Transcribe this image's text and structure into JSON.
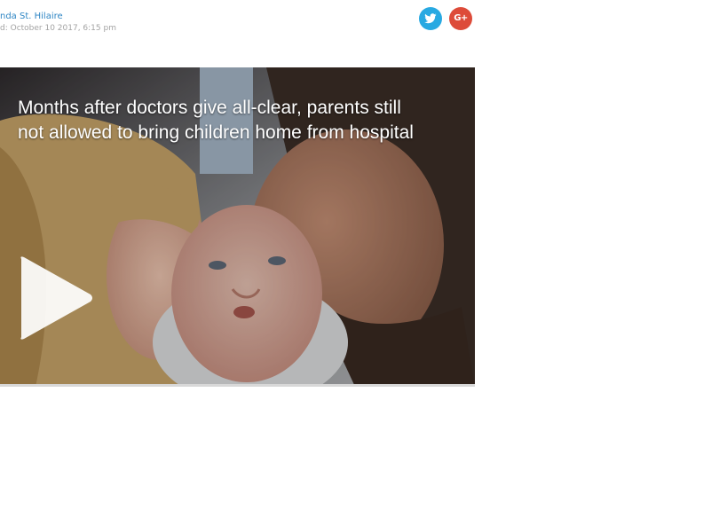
{
  "byline": {
    "author": "nda St. Hilaire",
    "posted": "d: October 10 2017, 6:15 pm"
  },
  "social": {
    "twitter_icon": "twitter-bird-icon",
    "gplus_icon": "google-plus-icon",
    "gplus_text": "G+",
    "twitter_color": "#28a9e2",
    "gplus_color": "#dd4b39"
  },
  "video": {
    "title_line1": "Months after doctors give all-clear, parents still",
    "title_line2": "not allowed to bring children home from hospital",
    "play_icon": "play-icon"
  }
}
